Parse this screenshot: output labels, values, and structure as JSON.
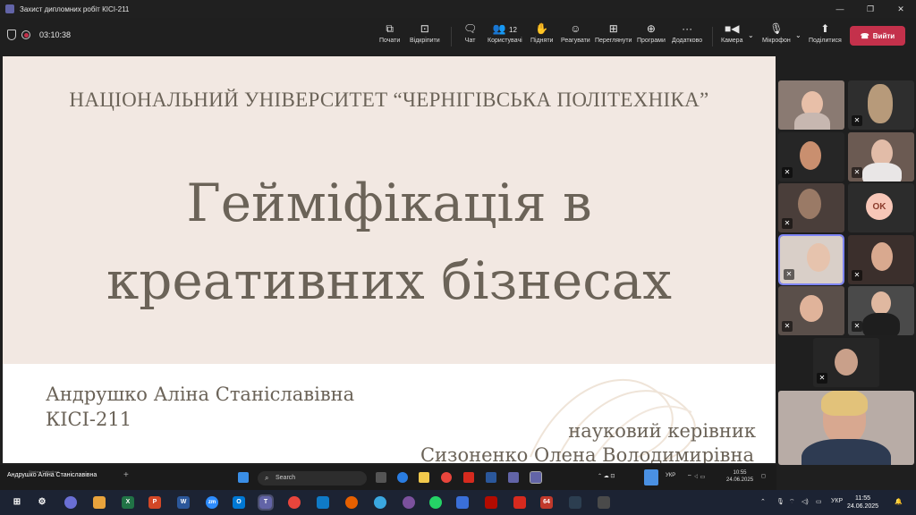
{
  "window": {
    "title": "Захист дипломних робіт КІСІ-211",
    "controls": [
      "—",
      "❐",
      "✕"
    ]
  },
  "toolbar": {
    "timer": "03:10:38",
    "buttons": [
      {
        "label": "Почати",
        "icon": "share-icon"
      },
      {
        "label": "Відкріпити",
        "icon": "unpin-icon"
      },
      {
        "label": "Чат",
        "icon": "chat-icon"
      },
      {
        "label": "Користувачі",
        "icon": "people-icon",
        "count": "12"
      },
      {
        "label": "Підняти",
        "icon": "raise-hand-icon"
      },
      {
        "label": "Реагувати",
        "icon": "react-icon"
      },
      {
        "label": "Переглянути",
        "icon": "view-icon"
      },
      {
        "label": "Програми",
        "icon": "apps-icon"
      },
      {
        "label": "Додатково",
        "icon": "more-icon"
      },
      {
        "label": "Камера",
        "icon": "camera-icon"
      },
      {
        "label": "Мікрофон",
        "icon": "microphone-icon"
      },
      {
        "label": "Поділитися",
        "icon": "share-screen-icon"
      }
    ],
    "leave_label": "Вийти"
  },
  "slide": {
    "university": "НАЦІОНАЛЬНИЙ УНІВЕРСИТЕТ “ЧЕРНІГІВСЬКА ПОЛІТЕХНІКА”",
    "title_line1": "Гейміфікація в",
    "title_line2": "креативних бізнесах",
    "author": "Андрушко Аліна Станіславівна",
    "group": "КІСІ-211",
    "supervisor_label": "науковий керівник",
    "supervisor_name": "Сизоненко Олена Володимирівна"
  },
  "participants": {
    "ok_initials": "OK"
  },
  "shared_bar": {
    "presenter_name": "Андрушко Аліна Станіславівна",
    "mini_text": "Starbea Pallentheri",
    "search_placeholder": "Search",
    "lang": "УКР",
    "time": "10:55",
    "date": "24.06.2025"
  },
  "taskbar": {
    "lang": "УКР",
    "time": "11:55",
    "date": "24.06.2025",
    "badge_64": "64"
  },
  "colors": {
    "slide_bg": "#f2e8e2",
    "slide_text": "#6b6358",
    "leave_red": "#c4314b",
    "teams_purple": "#6264a7",
    "active_outline": "#7f85f5"
  }
}
